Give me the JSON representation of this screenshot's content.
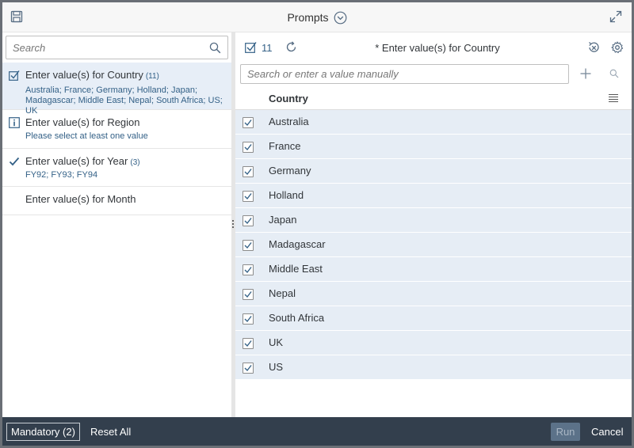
{
  "header": {
    "title": "Prompts"
  },
  "left": {
    "search_placeholder": "Search",
    "prompts": [
      {
        "title": "Enter value(s) for Country",
        "count": "(11)",
        "values": "Australia; France; Germany; Holland; Japan; Madagascar; Middle East; Nepal; South Africa; US; UK",
        "icon": "checkbox-icon",
        "selected": true
      },
      {
        "title": "Enter value(s) for Region",
        "count": "",
        "values": "Please select at least one value",
        "icon": "info-icon"
      },
      {
        "title": "Enter value(s) for Year",
        "count": "(3)",
        "values": "FY92; FY93; FY94",
        "icon": "checkmark-icon"
      },
      {
        "title": "Enter value(s) for Month",
        "count": "",
        "values": "",
        "icon": ""
      }
    ]
  },
  "right": {
    "selected_count": "11",
    "title": "* Enter value(s) for Country",
    "search_placeholder": "Search or enter a value manually",
    "column_header": "Country",
    "rows": [
      "Australia",
      "France",
      "Germany",
      "Holland",
      "Japan",
      "Madagascar",
      "Middle East",
      "Nepal",
      "South Africa",
      "UK",
      "US"
    ]
  },
  "footer": {
    "mandatory": "Mandatory (2)",
    "reset": "Reset All",
    "run": "Run",
    "cancel": "Cancel"
  },
  "colors": {
    "footer_bg": "#333f4d",
    "selected_row_bg": "#e6edf5",
    "link_blue": "#346187"
  }
}
